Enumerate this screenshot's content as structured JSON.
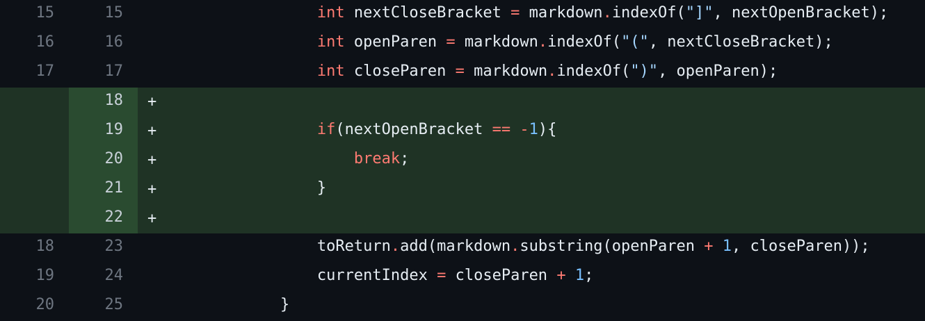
{
  "lines": [
    {
      "old": "15",
      "new": "15",
      "marker": "",
      "type": "context",
      "tokens": [
        {
          "t": "                ",
          "c": "plain"
        },
        {
          "t": "int",
          "c": "kw"
        },
        {
          "t": " nextCloseBracket ",
          "c": "plain"
        },
        {
          "t": "=",
          "c": "op"
        },
        {
          "t": " markdown",
          "c": "plain"
        },
        {
          "t": ".",
          "c": "op"
        },
        {
          "t": "indexOf(",
          "c": "plain"
        },
        {
          "t": "\"]\"",
          "c": "str"
        },
        {
          "t": ", nextOpenBracket);",
          "c": "plain"
        }
      ]
    },
    {
      "old": "16",
      "new": "16",
      "marker": "",
      "type": "context",
      "tokens": [
        {
          "t": "                ",
          "c": "plain"
        },
        {
          "t": "int",
          "c": "kw"
        },
        {
          "t": " openParen ",
          "c": "plain"
        },
        {
          "t": "=",
          "c": "op"
        },
        {
          "t": " markdown",
          "c": "plain"
        },
        {
          "t": ".",
          "c": "op"
        },
        {
          "t": "indexOf(",
          "c": "plain"
        },
        {
          "t": "\"(\"",
          "c": "str"
        },
        {
          "t": ", nextCloseBracket);",
          "c": "plain"
        }
      ]
    },
    {
      "old": "17",
      "new": "17",
      "marker": "",
      "type": "context",
      "tokens": [
        {
          "t": "                ",
          "c": "plain"
        },
        {
          "t": "int",
          "c": "kw"
        },
        {
          "t": " closeParen ",
          "c": "plain"
        },
        {
          "t": "=",
          "c": "op"
        },
        {
          "t": " markdown",
          "c": "plain"
        },
        {
          "t": ".",
          "c": "op"
        },
        {
          "t": "indexOf(",
          "c": "plain"
        },
        {
          "t": "\")\"",
          "c": "str"
        },
        {
          "t": ", openParen);",
          "c": "plain"
        }
      ]
    },
    {
      "old": "",
      "new": "18",
      "marker": "+",
      "type": "added",
      "tokens": []
    },
    {
      "old": "",
      "new": "19",
      "marker": "+",
      "type": "added",
      "tokens": [
        {
          "t": "                ",
          "c": "plain"
        },
        {
          "t": "if",
          "c": "kw"
        },
        {
          "t": "(nextOpenBracket ",
          "c": "plain"
        },
        {
          "t": "==",
          "c": "op"
        },
        {
          "t": " ",
          "c": "plain"
        },
        {
          "t": "-",
          "c": "op"
        },
        {
          "t": "1",
          "c": "num-lit"
        },
        {
          "t": "){",
          "c": "plain"
        }
      ]
    },
    {
      "old": "",
      "new": "20",
      "marker": "+",
      "type": "added",
      "tokens": [
        {
          "t": "                    ",
          "c": "plain"
        },
        {
          "t": "break",
          "c": "kw"
        },
        {
          "t": ";",
          "c": "plain"
        }
      ]
    },
    {
      "old": "",
      "new": "21",
      "marker": "+",
      "type": "added",
      "tokens": [
        {
          "t": "                ",
          "c": "plain"
        },
        {
          "t": "}",
          "c": "plain"
        }
      ]
    },
    {
      "old": "",
      "new": "22",
      "marker": "+",
      "type": "added",
      "tokens": []
    },
    {
      "old": "18",
      "new": "23",
      "marker": "",
      "type": "context",
      "tokens": [
        {
          "t": "                ",
          "c": "plain"
        },
        {
          "t": "toReturn",
          "c": "plain"
        },
        {
          "t": ".",
          "c": "op"
        },
        {
          "t": "add(markdown",
          "c": "plain"
        },
        {
          "t": ".",
          "c": "op"
        },
        {
          "t": "substring(openParen ",
          "c": "plain"
        },
        {
          "t": "+",
          "c": "op"
        },
        {
          "t": " ",
          "c": "plain"
        },
        {
          "t": "1",
          "c": "num-lit"
        },
        {
          "t": ", closeParen));",
          "c": "plain"
        }
      ]
    },
    {
      "old": "19",
      "new": "24",
      "marker": "",
      "type": "context",
      "tokens": [
        {
          "t": "                ",
          "c": "plain"
        },
        {
          "t": "currentIndex ",
          "c": "plain"
        },
        {
          "t": "=",
          "c": "op"
        },
        {
          "t": " closeParen ",
          "c": "plain"
        },
        {
          "t": "+",
          "c": "op"
        },
        {
          "t": " ",
          "c": "plain"
        },
        {
          "t": "1",
          "c": "num-lit"
        },
        {
          "t": ";",
          "c": "plain"
        }
      ]
    },
    {
      "old": "20",
      "new": "25",
      "marker": "",
      "type": "context",
      "tokens": [
        {
          "t": "            ",
          "c": "plain"
        },
        {
          "t": "}",
          "c": "plain"
        }
      ]
    }
  ],
  "colors": {
    "background": "#0d1117",
    "added_background": "#1f3325",
    "added_gutter": "#2a4b30",
    "keyword": "#ff7b72",
    "string": "#a5d6ff",
    "number": "#79c0ff"
  }
}
